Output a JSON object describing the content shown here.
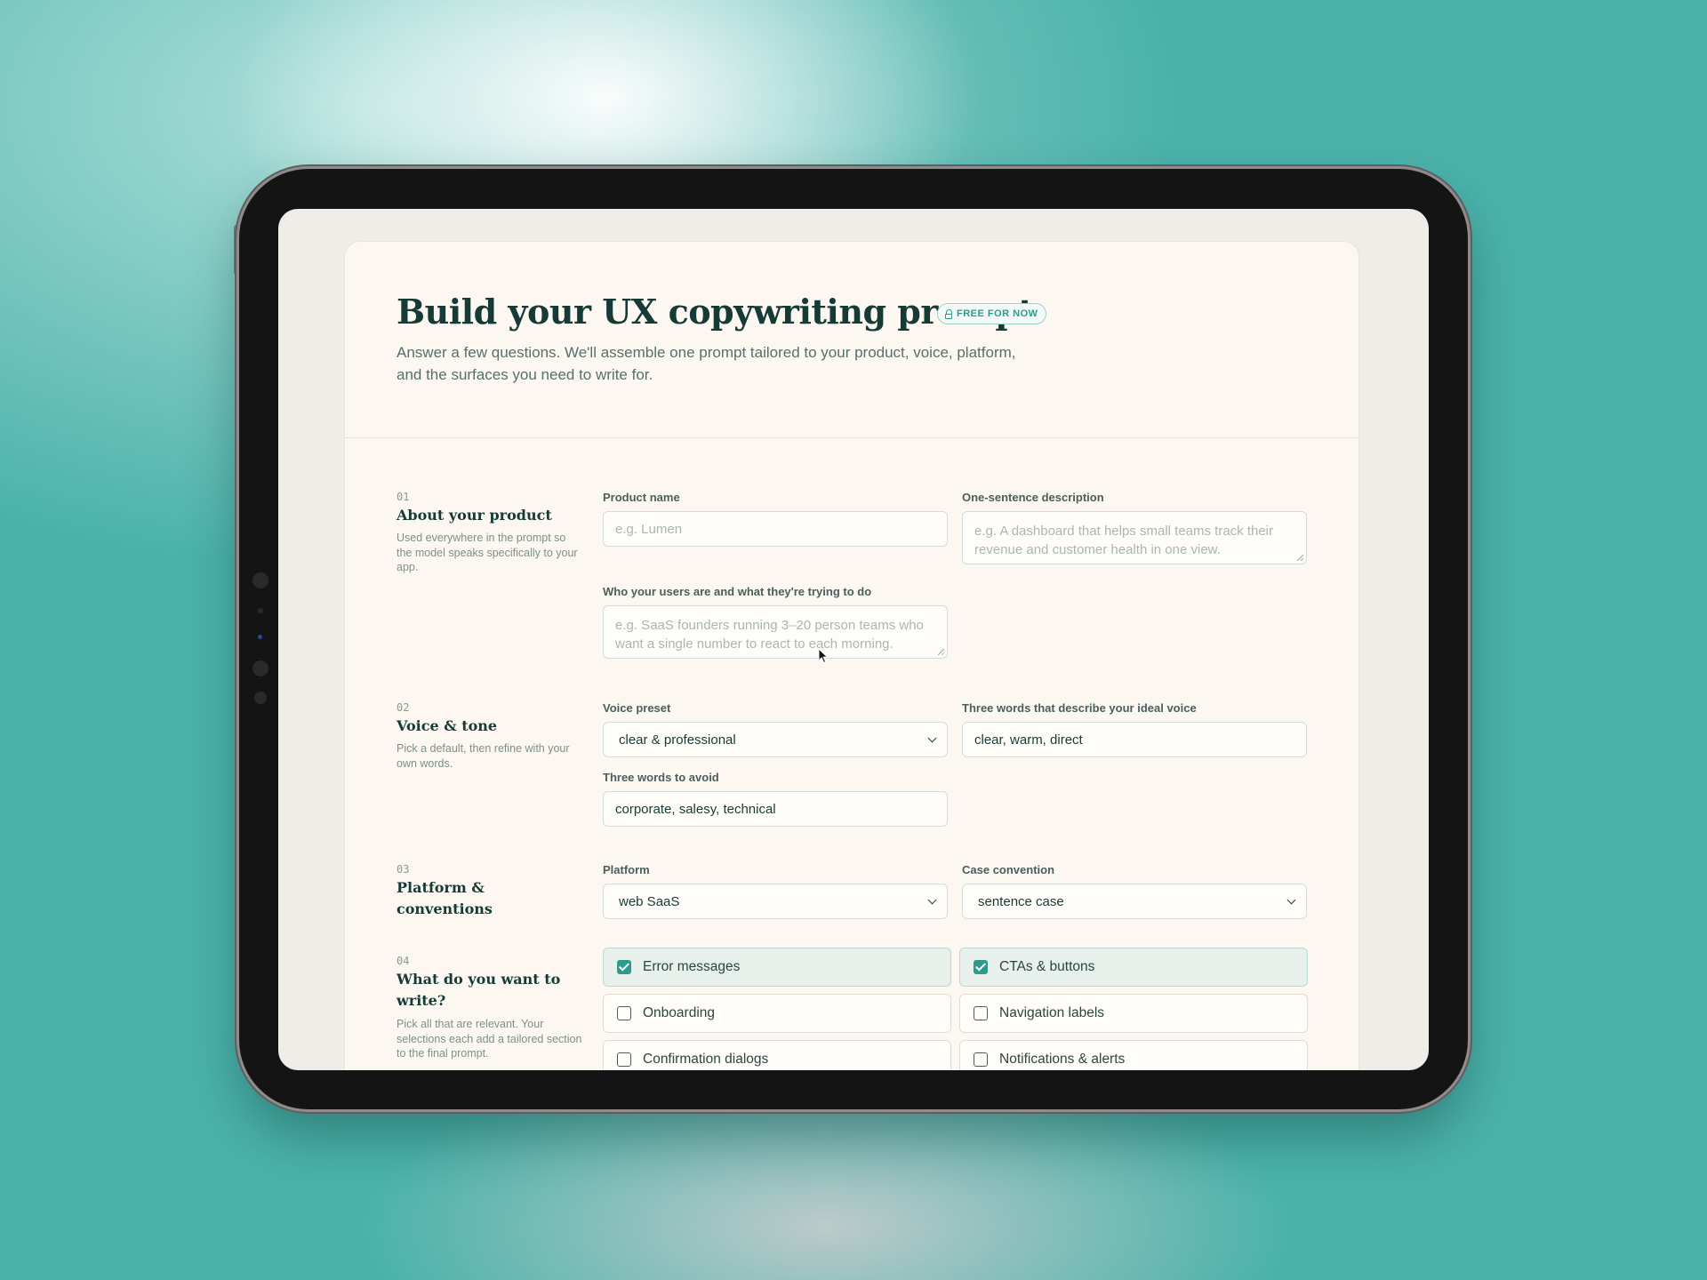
{
  "header": {
    "title": "Build your UX copywriting prompt",
    "badge": "FREE FOR NOW",
    "subtitle": "Answer a few questions. We'll assemble one prompt tailored to your product, voice, platform, and the surfaces you need to write for."
  },
  "sections": {
    "product": {
      "number": "01",
      "title": "About your product",
      "description": "Used everywhere in the prompt so the model speaks specifically to your app.",
      "product_name": {
        "label": "Product name",
        "value": "",
        "placeholder": "e.g. Lumen"
      },
      "description_field": {
        "label": "One-sentence description",
        "value": "",
        "placeholder": "e.g. A dashboard that helps small teams track their revenue and customer health in one view."
      },
      "users_field": {
        "label": "Who your users are and what they're trying to do",
        "value": "",
        "placeholder": "e.g. SaaS founders running 3–20 person teams who want a single number to react to each morning."
      }
    },
    "voice": {
      "number": "02",
      "title": "Voice & tone",
      "description": "Pick a default, then refine with your own words.",
      "preset": {
        "label": "Voice preset",
        "value": "clear & professional"
      },
      "describe": {
        "label": "Three words that describe your ideal voice",
        "value": "clear, warm, direct"
      },
      "avoid": {
        "label": "Three words to avoid",
        "value": "corporate, salesy, technical"
      }
    },
    "platform": {
      "number": "03",
      "title": "Platform & conventions",
      "platform": {
        "label": "Platform",
        "value": "web SaaS"
      },
      "case": {
        "label": "Case convention",
        "value": "sentence case"
      }
    },
    "surfaces": {
      "number": "04",
      "title": "What do you want to write?",
      "description": "Pick all that are relevant. Your selections each add a tailored section to the final prompt.",
      "options": [
        {
          "label": "Error messages",
          "checked": true
        },
        {
          "label": "CTAs & buttons",
          "checked": true
        },
        {
          "label": "Onboarding",
          "checked": false
        },
        {
          "label": "Navigation labels",
          "checked": false
        },
        {
          "label": "Confirmation dialogs",
          "checked": false
        },
        {
          "label": "Notifications & alerts",
          "checked": false
        }
      ]
    }
  },
  "colors": {
    "accent": "#2f9a8c",
    "heading": "#163a36",
    "card": "#fcf8f1",
    "backdrop": "#4bb2ab"
  }
}
